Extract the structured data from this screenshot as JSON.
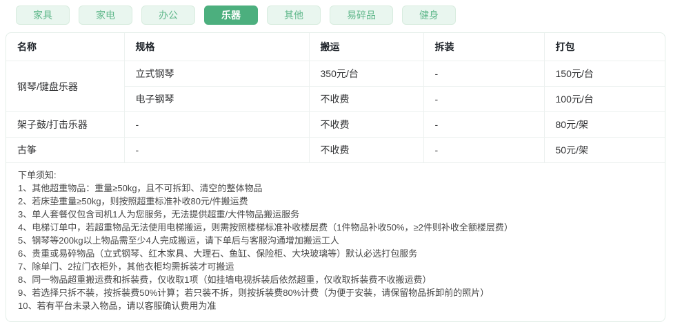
{
  "tabs": [
    {
      "label": "家具",
      "active": false
    },
    {
      "label": "家电",
      "active": false
    },
    {
      "label": "办公",
      "active": false
    },
    {
      "label": "乐器",
      "active": true
    },
    {
      "label": "其他",
      "active": false
    },
    {
      "label": "易碎品",
      "active": false
    },
    {
      "label": "健身",
      "active": false
    }
  ],
  "colors": {
    "active_tab": "#4caf7e",
    "inactive_tab_bg": "#e9f6ef",
    "inactive_tab_text": "#60b88b",
    "table_border": "#ecf1ef"
  },
  "table": {
    "headers": [
      "名称",
      "规格",
      "搬运",
      "拆装",
      "打包"
    ],
    "rows": [
      [
        {
          "text": "钢琴/键盘乐器",
          "rowspan": 2
        },
        {
          "text": "立式钢琴"
        },
        {
          "text": "350元/台"
        },
        {
          "text": "-"
        },
        {
          "text": "150元/台"
        }
      ],
      [
        {
          "text": "电子钢琴"
        },
        {
          "text": "不收费"
        },
        {
          "text": "-"
        },
        {
          "text": "100元/台"
        }
      ],
      [
        {
          "text": "架子鼓/打击乐器"
        },
        {
          "text": "-"
        },
        {
          "text": "不收费"
        },
        {
          "text": "-"
        },
        {
          "text": "80元/架"
        }
      ],
      [
        {
          "text": "古筝"
        },
        {
          "text": "-"
        },
        {
          "text": "不收费"
        },
        {
          "text": "-"
        },
        {
          "text": "50元/架"
        }
      ]
    ]
  },
  "notes": {
    "title": "下单须知:",
    "items": [
      "1、其他超重物品：重量≥50kg，且不可拆卸、清空的整体物品",
      "2、若床垫重量≥50kg，则按照超重标准补收80元/件搬运费",
      "3、单人套餐仅包含司机1人为您服务，无法提供超重/大件物品搬运服务",
      "4、电梯订单中，若超重物品无法使用电梯搬运，则需按照楼梯标准补收楼层费（1件物品补收50%，≥2件则补收全额楼层费）",
      "5、钢琴等200kg以上物品需至少4人完成搬运，请下单后与客服沟通增加搬运工人",
      "6、贵重或易碎物品（立式钢琴、红木家具、大理石、鱼缸、保险柜、大块玻璃等）默认必选打包服务",
      "7、除单门、2拉门衣柜外，其他衣柜均需拆装才可搬运",
      "8、同一物品超重搬运费和拆装费，仅收取1项（如挂墙电视拆装后依然超重，仅收取拆装费不收搬运费）",
      "9、若选择只拆不装，按拆装费50%计算；若只装不拆，则按拆装费80%计费（为便于安装，请保留物品拆卸前的照片）",
      "10、若有平台未录入物品，请以客服确认费用为准"
    ]
  }
}
